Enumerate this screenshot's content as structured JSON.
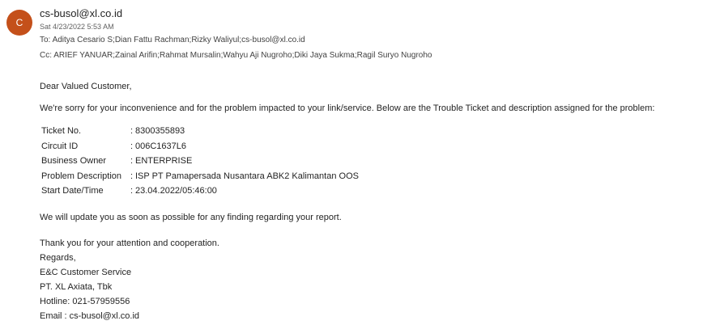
{
  "header": {
    "avatar_initial": "C",
    "avatar_color": "#c4501a",
    "sender": "cs-busol@xl.co.id",
    "date": "Sat 4/23/2022 5:53 AM",
    "to_label": "To:",
    "to_recipients": "Aditya Cesario S;Dian Fattu Rachman;Rizky Waliyul;cs-busol@xl.co.id",
    "cc_label": "Cc:",
    "cc_recipients": "ARIEF YANUAR;Zainal Arifin;Rahmat Mursalin;Wahyu Aji Nugroho;Diki Jaya Sukma;Ragil Suryo Nugroho"
  },
  "body": {
    "greeting": "Dear Valued Customer,",
    "intro": "We're sorry for your inconvenience and for the problem impacted to your link/service. Below are the Trouble Ticket and description assigned for the problem:",
    "ticket": [
      {
        "label": "Ticket No.",
        "sep": ":",
        "value": "8300355893"
      },
      {
        "label": "Circuit ID",
        "sep": ":",
        "value": "006C1637L6"
      },
      {
        "label": "Business Owner",
        "sep": ":",
        "value": "ENTERPRISE"
      },
      {
        "label": "Problem Description",
        "sep": ":",
        "value": "ISP PT Pamapersada Nusantara ABK2 Kalimantan OOS"
      },
      {
        "label": "Start Date/Time",
        "sep": ":",
        "value": "23.04.2022/05:46:00"
      }
    ],
    "update": "We will update you as soon as possible for any finding regarding your report.",
    "thanks": "Thank you for your attention and cooperation.",
    "signature": {
      "regards": "Regards,",
      "team": "E&C Customer Service",
      "company": "PT. XL Axiata, Tbk",
      "hotline": "Hotline: 021-57959556",
      "email": "Email : cs-busol@xl.co.id"
    }
  }
}
